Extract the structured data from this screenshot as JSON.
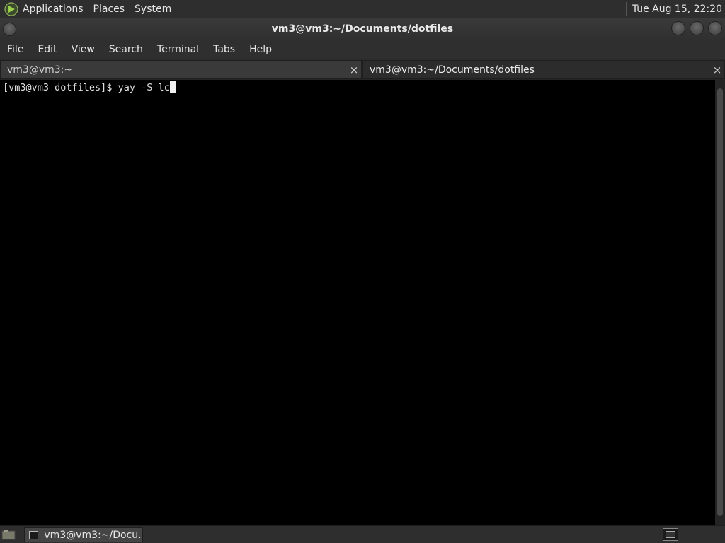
{
  "top_panel": {
    "menus": [
      "Applications",
      "Places",
      "System"
    ],
    "apps_icon": "mate-logo-icon",
    "clock": "Tue Aug 15, 22:20"
  },
  "window": {
    "title": "vm3@vm3:~/Documents/dotfiles",
    "controls": [
      "minimize-icon",
      "maximize-icon",
      "close-icon"
    ]
  },
  "menubar": {
    "items": [
      "File",
      "Edit",
      "View",
      "Search",
      "Terminal",
      "Tabs",
      "Help"
    ]
  },
  "tabs": [
    {
      "label": "vm3@vm3:~",
      "close": "×"
    },
    {
      "label": "vm3@vm3:~/Documents/dotfiles",
      "close": "×"
    }
  ],
  "terminal": {
    "prompt": "[vm3@vm3 dotfiles]$ ",
    "command": "yay -S lc"
  },
  "bottom_panel": {
    "task_label": "vm3@vm3:~/Docu..."
  }
}
